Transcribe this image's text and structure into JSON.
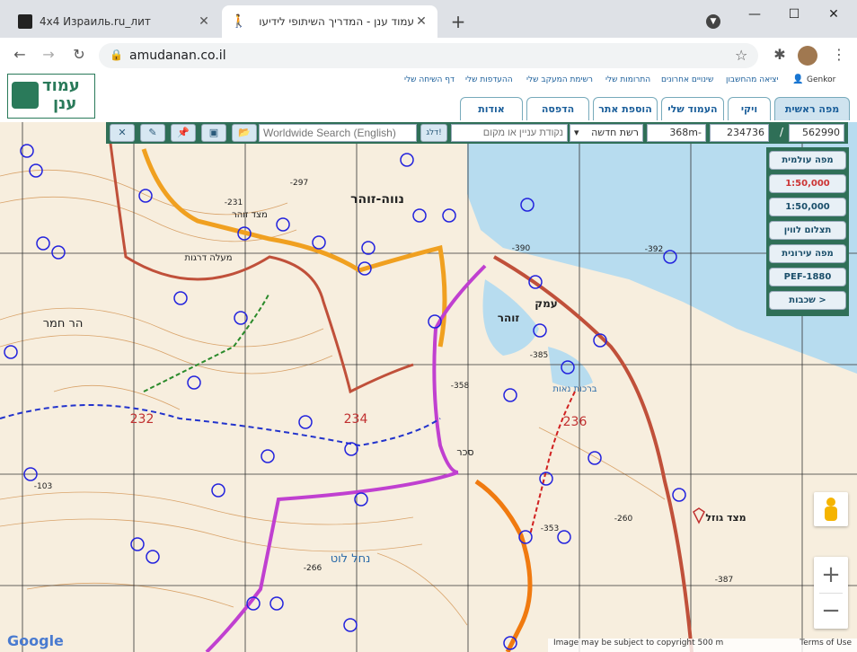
{
  "browser": {
    "tabs": [
      {
        "title": "4x4 Израиль.ru_лит"
      },
      {
        "title": "עמוד ענן - המדריך השיתופי לידיעו"
      }
    ],
    "url": "amudanan.co.il"
  },
  "site": {
    "logo_line1": "עמוד",
    "logo_line2": "ענן",
    "user": "Genkor",
    "top_links": [
      "יציאה מהחשבון",
      "שינויים אחרונים",
      "התרומות שלי",
      "רשימת המעקב שלי",
      "ההעדפות שלי",
      "דף השיחה שלי"
    ],
    "nav_tabs": [
      "מפה ראשית",
      "ויקי",
      "העמוד שלי",
      "הוספת אתר",
      "הדפסה",
      "אודות"
    ]
  },
  "map_toolbar": {
    "search_placeholder": "Worldwide Search (English)",
    "go_label": "דלג!",
    "poi_placeholder": "נקודת עניין או מקום",
    "grid_select": "רשת חדשה",
    "elevation": "368m-",
    "coord_x": "234736",
    "separator": "/",
    "coord_y": "562990"
  },
  "layers": [
    {
      "label": "מפה עולמית",
      "selected": false
    },
    {
      "label": "1:50,000",
      "selected": true
    },
    {
      "label": "1:50,000 קלאסית",
      "selected": false
    },
    {
      "label": "תצלום לווין",
      "selected": false
    },
    {
      "label": "מפה עירונית",
      "selected": false
    },
    {
      "label": "PEF-1880",
      "selected": false
    },
    {
      "label": "שכבות >",
      "selected": false
    }
  ],
  "map_labels": {
    "l1": "נווה-זוהר",
    "l2": "עמק",
    "l3": "זוהר",
    "l4": "הר חמר",
    "l5": "מצד גוזל",
    "l6": "נחל לוט",
    "l7": "232",
    "l8": "234",
    "l9": "236",
    "l10": "-390",
    "l11": "-392",
    "l12": "-385",
    "l13": "-358",
    "l14": "-353",
    "l15": "-260",
    "l16": "-387",
    "l17": "-266",
    "l18": "-297",
    "l19": "-231",
    "l20": "-103",
    "l21": "מעלה דרגות",
    "l22": "מצד זוהר",
    "l23": "סכר",
    "l24": "ברכות נאות"
  },
  "map_controls": {
    "zoom_in": "+",
    "zoom_out": "−"
  },
  "attribution": "Image may be subject to copyright   500 m",
  "terms": "Terms of Use",
  "google": "Google"
}
